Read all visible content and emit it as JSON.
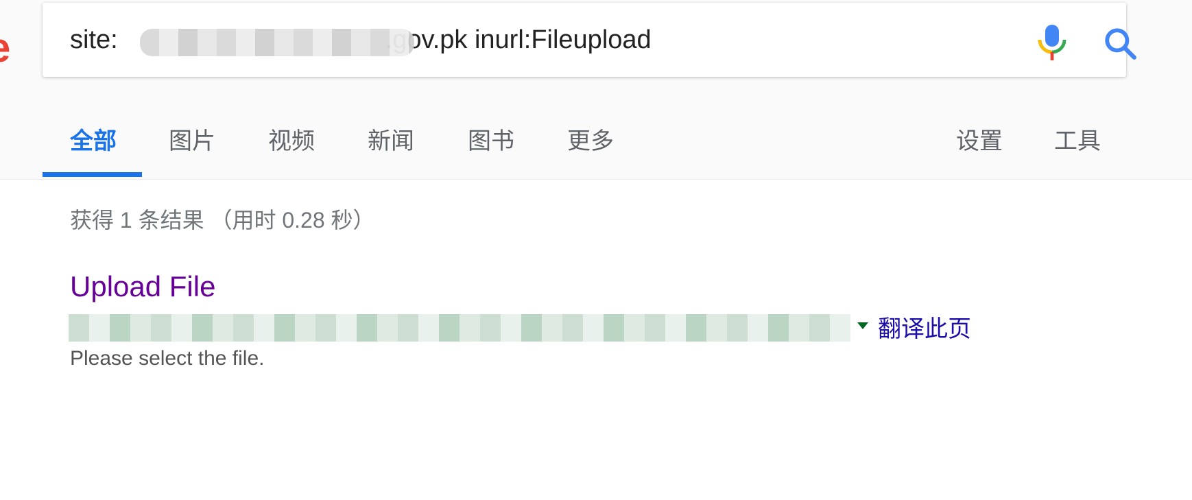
{
  "search": {
    "query": "site:.....gov.pk inurl:Fileupload",
    "query_prefix": "site:",
    "query_suffix": ".gov.pk inurl:Fileupload"
  },
  "tabs": [
    {
      "label": "全部",
      "active": true
    },
    {
      "label": "图片"
    },
    {
      "label": "视频"
    },
    {
      "label": "新闻"
    },
    {
      "label": "图书"
    },
    {
      "label": "更多"
    }
  ],
  "tools": {
    "settings": "设置",
    "tools": "工具"
  },
  "results": {
    "stats": "获得 1 条结果 （用时 0.28 秒）",
    "items": [
      {
        "title": "Upload File",
        "translate": "翻译此页",
        "snippet": "Please select the file."
      }
    ]
  },
  "colors": {
    "accent": "#1a73e8",
    "visited_link": "#660099",
    "link": "#1a0dab",
    "url_green": "#006621"
  },
  "icons": {
    "mic": "microphone-icon",
    "search": "search-icon"
  }
}
